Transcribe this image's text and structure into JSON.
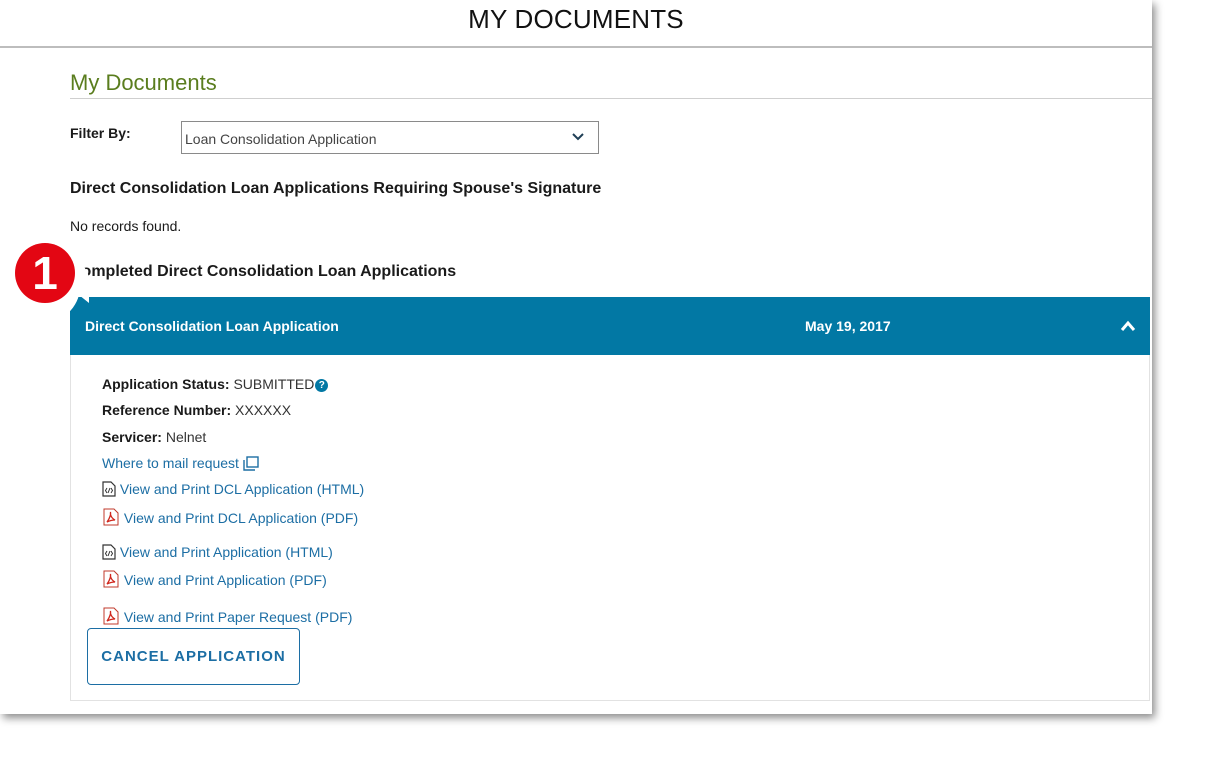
{
  "page": {
    "title": "MY DOCUMENTS"
  },
  "section": {
    "heading": "My Documents"
  },
  "filter": {
    "label": "Filter By:",
    "selected": "Loan Consolidation Application"
  },
  "spouse_section": {
    "heading": "Direct Consolidation Loan Applications Requiring Spouse's Signature",
    "empty_text": "No records found."
  },
  "completed_section": {
    "heading": "Completed Direct Consolidation Loan Applications",
    "callout_number": "1"
  },
  "application": {
    "title": "Direct Consolidation Loan Application",
    "date": "May 19, 2017",
    "status_label": "Application Status:",
    "status_value": "SUBMITTED",
    "reference_label": "Reference Number:",
    "reference_value": "XXXXXX",
    "servicer_label": "Servicer:",
    "servicer_value": "Nelnet",
    "links": {
      "mail": "Where to mail request",
      "dcl_html": "View and Print DCL Application (HTML)",
      "dcl_pdf": "View and Print DCL Application (PDF)",
      "app_html": "View and Print Application (HTML)",
      "app_pdf": "View and Print Application (PDF)",
      "paper_pdf": "View and Print Paper Request (PDF)"
    },
    "cancel_label": "CANCEL APPLICATION"
  },
  "colors": {
    "accent_blue": "#0278a4",
    "heading_green": "#5a7d1e",
    "link_blue": "#1c6ea4",
    "callout_red": "#e30613"
  }
}
